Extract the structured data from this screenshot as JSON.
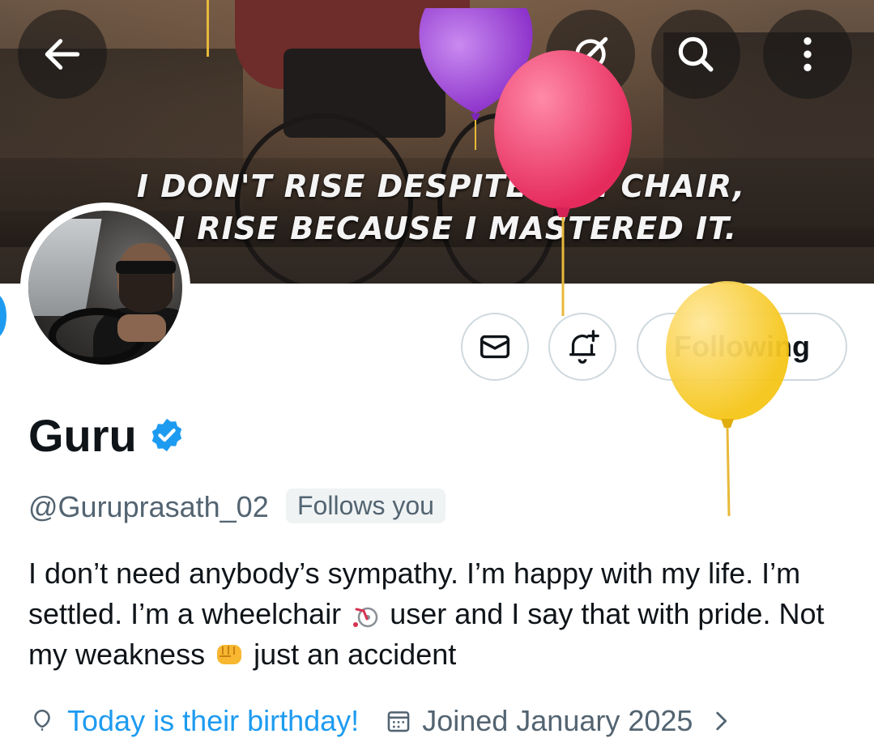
{
  "header": {
    "banner_quote_line1": "I DON'T RISE DESPITE THE CHAIR,",
    "banner_quote_line2": "I RISE BECAUSE I MASTERED IT."
  },
  "top_bar": {
    "back_icon": "arrow-left-icon",
    "grok_icon": "grok-icon",
    "search_icon": "search-icon",
    "more_icon": "more-vertical-icon"
  },
  "actions": {
    "message_icon": "envelope-icon",
    "notify_icon": "bell-plus-icon",
    "following_label": "Following"
  },
  "profile": {
    "name": "Guru",
    "verified_icon": "verified-badge-icon",
    "handle": "@Guruprasath_02",
    "follows_you": "Follows you",
    "bio_part1": "I don’t need anybody’s sympathy. I’m happy with my life. I’m settled. I’m a wheelchair ",
    "bio_part2": " user and I say that with pride. Not my weakness ",
    "bio_part3": " just an accident",
    "birthday": "Today is their birthday!",
    "joined": "Joined January 2025"
  },
  "colors": {
    "accent": "#1d9bf0",
    "secondary_text": "#536471",
    "primary_text": "#0f1419",
    "balloon_purple": "#9b3fd6",
    "balloon_pink": "#ef3a6a",
    "balloon_yellow": "#ffd22e"
  }
}
